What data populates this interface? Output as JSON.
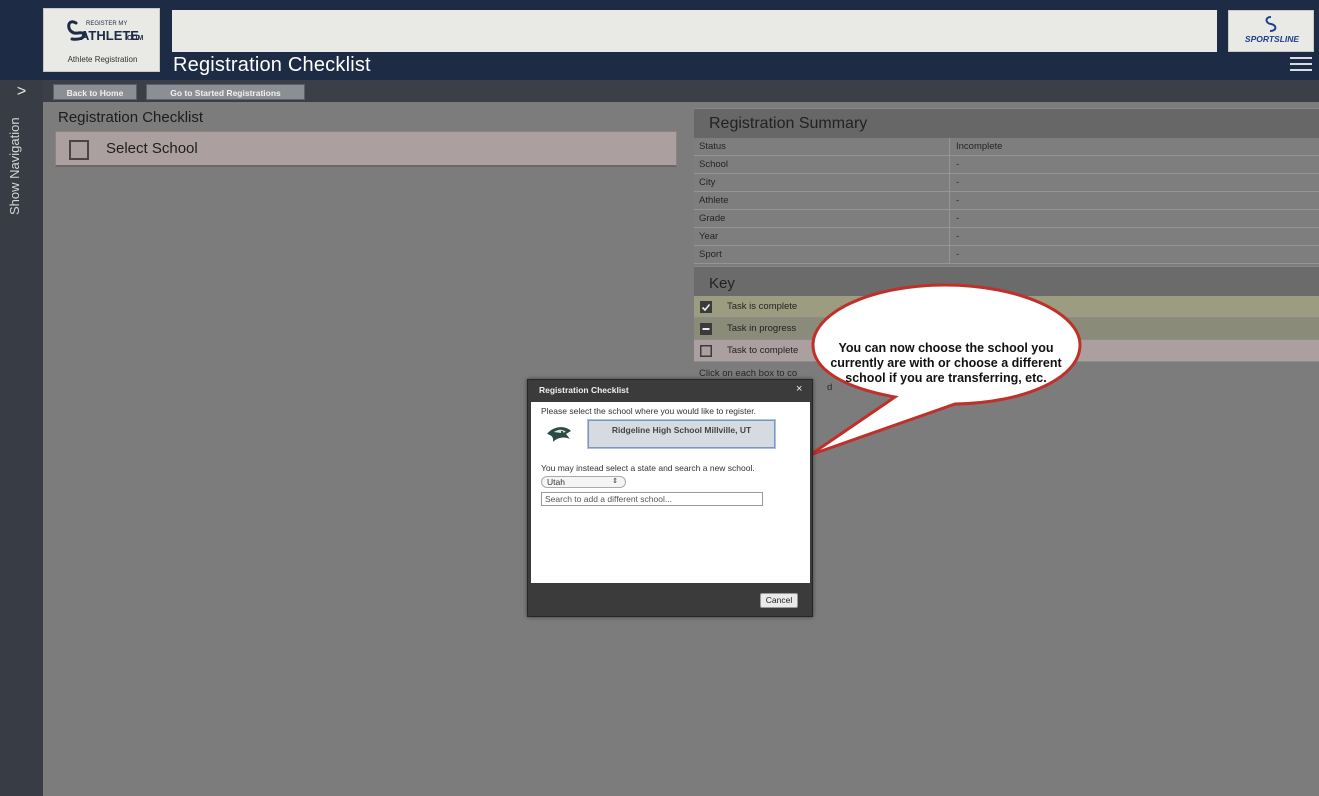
{
  "header": {
    "logo_top": "REGISTER MY",
    "logo_main": "ATHLETE",
    "logo_suffix": ".COM",
    "logo_subtitle": "Athlete Registration",
    "title": "Registration Checklist",
    "partner_logo": "SPORTSLINE"
  },
  "nav": {
    "toggle_label": "Show Navigation",
    "buttons": {
      "home": "Back to Home",
      "started": "Go to Started Registrations"
    }
  },
  "checklist": {
    "title": "Registration Checklist",
    "items": [
      {
        "label": "Select School",
        "state": "todo"
      }
    ]
  },
  "summary": {
    "title": "Registration Summary",
    "rows": [
      {
        "label": "Status",
        "value": "Incomplete"
      },
      {
        "label": "School",
        "value": "-"
      },
      {
        "label": "City",
        "value": "-"
      },
      {
        "label": "Athlete",
        "value": "-"
      },
      {
        "label": "Grade",
        "value": "-"
      },
      {
        "label": "Year",
        "value": "-"
      },
      {
        "label": "Sport",
        "value": "-"
      }
    ]
  },
  "key": {
    "title": "Key",
    "complete": "Task is complete",
    "progress": "Task in progress",
    "todo": "Task to complete",
    "help": "Click on each box to co",
    "help_line2": "d"
  },
  "callout": {
    "text": "You can now choose the school you currently are with or choose a different school if you are transferring, etc."
  },
  "modal": {
    "title": "Registration Checklist",
    "close": "×",
    "instruction": "Please select the school where you would like to register.",
    "school_option": "Ridgeline High School Millville, UT",
    "alt_instruction": "You may instead select a state and search a new school.",
    "state_value": "Utah",
    "search_placeholder": "Search to add a different school...",
    "cancel": "Cancel"
  },
  "colors": {
    "header_bg": "#1d2b45",
    "rail_bg": "#383d45",
    "callout_border": "#c0302a"
  },
  "icons": [
    "chevron-right-icon",
    "hamburger-menu-icon",
    "checkbox-icon",
    "school-mascot-icon"
  ]
}
